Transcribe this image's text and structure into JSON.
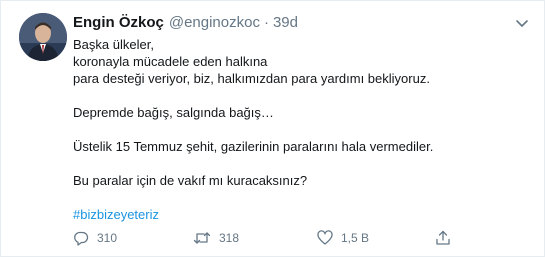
{
  "tweet": {
    "name": "Engin Özkoç",
    "handle": "@enginozkoc",
    "separator": "·",
    "time": "39d",
    "lines": [
      "Başka ülkeler,",
      "koronayla mücadele eden halkına",
      "para desteği veriyor, biz, halkımızdan para yardımı bekliyoruz.",
      "",
      "Depremde bağış, salgında bağış…",
      "",
      "Üstelik 15 Temmuz şehit, gazilerinin paralarını hala vermediler.",
      "",
      "Bu paralar için de vakıf mı kuracaksınız?",
      "",
      "#bizbizeyeteriz"
    ],
    "hashtag_color": "#1b95e0"
  },
  "actions": {
    "replies": "310",
    "retweets": "318",
    "likes": "1,5 B"
  },
  "colors": {
    "text": "#14171a",
    "muted": "#657786",
    "border": "#e6ecf0",
    "link": "#1b95e0"
  },
  "icons": {
    "reply": "reply-icon",
    "retweet": "retweet-icon",
    "like": "heart-icon",
    "share": "share-icon",
    "caret": "chevron-down-icon"
  }
}
